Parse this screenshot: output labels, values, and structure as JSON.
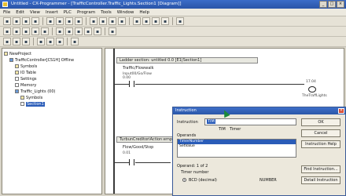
{
  "window": {
    "title": "Untitled - CX-Programmer - [TrafficController.Traffic_Lights.Section1 [Diagram]]",
    "controls": [
      "_",
      "□",
      "×"
    ]
  },
  "menu": [
    "File",
    "Edit",
    "View",
    "Insert",
    "PLC",
    "Program",
    "Tools",
    "Window",
    "Help"
  ],
  "toolbar_icons": {
    "row1": [
      "new-icon",
      "open-icon",
      "save-icon",
      "print-icon",
      "cut-icon",
      "copy-icon",
      "paste-icon",
      "undo-icon",
      "redo-icon",
      "find-icon",
      "zoom-icon",
      "grid-icon",
      "online-icon",
      "monitor-icon",
      "transfer-icon",
      "compile-icon",
      "help-icon"
    ],
    "row2": [
      "select-icon",
      "contact-icon",
      "nc-contact-icon",
      "coil-icon",
      "nc-coil-icon",
      "instruction-icon",
      "line-icon",
      "vertical-icon",
      "comment-icon",
      "bus-icon",
      "jump-icon"
    ],
    "row3": [
      "project-icon",
      "output-icon",
      "watch-icon",
      "xref-icon",
      "addr-icon",
      "symbol-icon",
      "monitor2-icon"
    ]
  },
  "tree": {
    "root": "NewProject",
    "items": [
      {
        "label": "TrafficController[CS1H] Offline",
        "icon": "plc-icon",
        "indent": 1
      },
      {
        "label": "Symbols",
        "icon": "symbols-icon",
        "indent": 2
      },
      {
        "label": "IO Table",
        "icon": "io-table-icon",
        "indent": 2
      },
      {
        "label": "Settings",
        "icon": "settings-icon",
        "indent": 2
      },
      {
        "label": "Memory",
        "icon": "memory-icon",
        "indent": 2
      },
      {
        "label": "Traffic_Lights (00)",
        "icon": "program-icon",
        "indent": 2
      },
      {
        "label": "Symbols",
        "icon": "symbols-icon",
        "indent": 3
      },
      {
        "label": "Section1",
        "icon": "section-icon",
        "indent": 3,
        "selected": true
      }
    ]
  },
  "ladder": {
    "section_header": "Ladder section: untitled 0.0 [E1|Section1]",
    "rung1_label": "Traffic/Flowwalk",
    "rung1_sub1": "Input00/Go/Flow",
    "rung1_sub2": "0.00",
    "coil_addr": "17.04",
    "coil_name": "TheTraffLights",
    "rung2_header": "TurbunCreditoriAction:empties",
    "rung2_label": "Flow/Good/Stop",
    "rung2_sub": "0.01"
  },
  "dialog": {
    "title": "Instruction",
    "instruction_label": "Instruction",
    "instruction_value": "TIM",
    "hint_line1": "TIM",
    "hint_line2": "Timer",
    "operands_label": "Operands",
    "operands_items": [
      "TimerNumber",
      "SetValue"
    ],
    "selected_operand_index": 0,
    "operand_info": "Operand: 1 of 2",
    "operand_desc": "Timer number",
    "radio_label": "BCD (decimal)",
    "radio_type": "NUMBER",
    "buttons": [
      "OK",
      "Cancel",
      "Instruction Help",
      "Find Instruction...",
      "Detail Instruction"
    ]
  },
  "colors": {
    "title_bar": "#2b57a8",
    "selection": "#2a5cb8",
    "cursor": "#1a8a3a"
  }
}
